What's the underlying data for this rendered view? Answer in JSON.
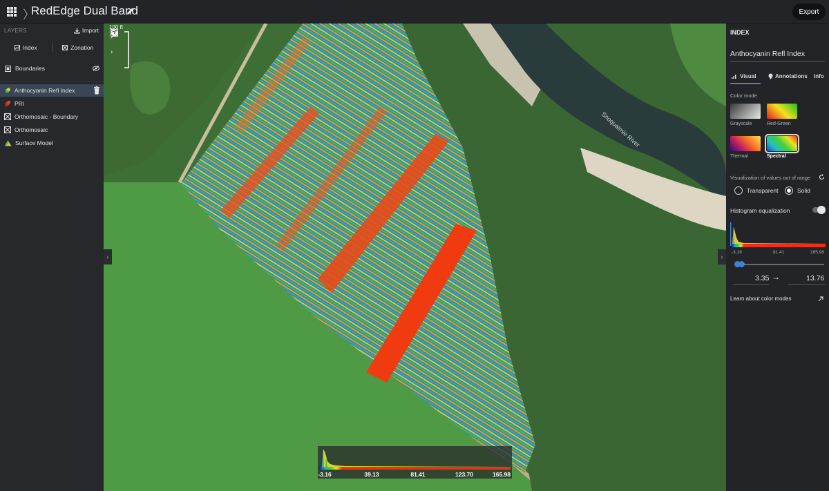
{
  "topbar": {
    "title": "RedEdge Dual Band",
    "export_label": "Export"
  },
  "layers_panel": {
    "header": "LAYERS",
    "import_label": "Import",
    "index_label": "Index",
    "zonation_label": "Zonation",
    "boundaries_label": "Boundaries",
    "items": [
      {
        "label": "Anthocyanin Refl Index",
        "icon": "spectral-leaf-icon",
        "selected": true
      },
      {
        "label": "PRI",
        "icon": "red-leaf-icon"
      },
      {
        "label": "Orthomosaic - Boundary",
        "icon": "orthomosaic-icon"
      },
      {
        "label": "Orthomosaic",
        "icon": "orthomosaic-icon"
      },
      {
        "label": "Surface Model",
        "icon": "surface-model-icon"
      }
    ]
  },
  "map": {
    "river_label": "Snoqualmie River",
    "scale_label": "100 ft",
    "legend": {
      "ticks": [
        "-3.16",
        "39.13",
        "81.41",
        "123.70",
        "165.98"
      ]
    }
  },
  "index_panel": {
    "header": "INDEX",
    "layer_name": "Anthocyanin Refl Index",
    "tabs": [
      "Visual",
      "Annotations",
      "Info"
    ],
    "color_mode_label": "Color mode",
    "color_modes": [
      {
        "label": "Grayscale",
        "colors": [
          "#3a3a3a",
          "#e8e8e8"
        ]
      },
      {
        "label": "Red-Green",
        "colors": [
          "#e02020",
          "#f5e020",
          "#20c020"
        ]
      },
      {
        "label": "Thermal",
        "colors": [
          "#2a1070",
          "#c02060",
          "#ff8020",
          "#ffe060"
        ]
      },
      {
        "label": "Spectral",
        "colors": [
          "#2040d0",
          "#20c0c0",
          "#40d040",
          "#f0e020",
          "#f03020"
        ],
        "selected": true
      }
    ],
    "out_of_range_label": "Visualization of values out of range",
    "transparent_label": "Transparent",
    "solid_label": "Solid",
    "histogram_eq_label": "Histogram equalization",
    "hist_ticks": [
      "-3.16",
      "81.41",
      "165.98"
    ],
    "range_min": "3.35",
    "range_max": "13.76",
    "learn_label": "Learn about color modes"
  }
}
